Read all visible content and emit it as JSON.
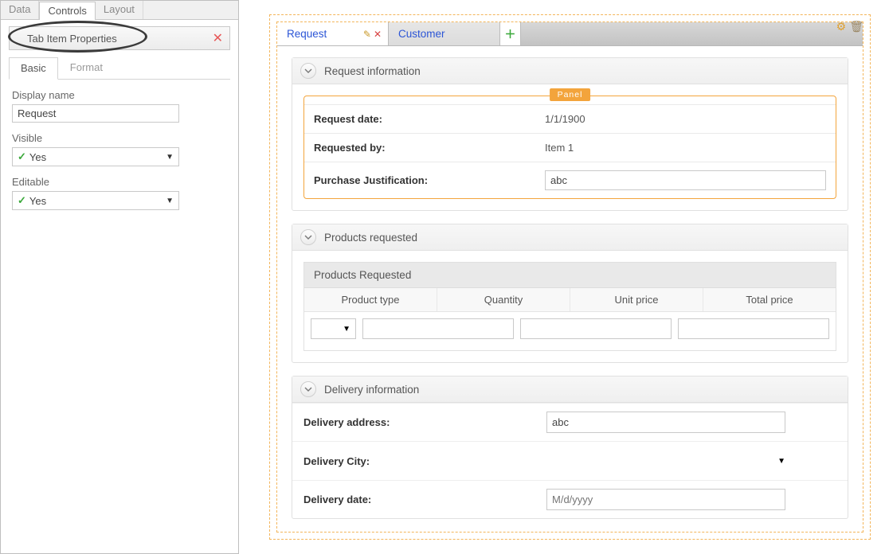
{
  "sidebar": {
    "tabs": [
      "Data",
      "Controls",
      "Layout"
    ],
    "panel_title": "Tab Item Properties",
    "subtabs": [
      "Basic",
      "Format"
    ],
    "display_name_label": "Display name",
    "display_name_value": "Request",
    "visible_label": "Visible",
    "visible_value": "Yes",
    "editable_label": "Editable",
    "editable_value": "Yes"
  },
  "canvas": {
    "tabs": [
      {
        "label": "Request",
        "active": true
      },
      {
        "label": "Customer",
        "active": false
      }
    ],
    "panel_badge": "Panel",
    "sec_request_title": "Request information",
    "request_date_label": "Request date:",
    "request_date_value": "1/1/1900",
    "requested_by_label": "Requested by:",
    "requested_by_value": "Item 1",
    "purchase_just_label": "Purchase Justification:",
    "purchase_just_value": "abc",
    "sec_products_title": "Products requested",
    "table_title": "Products Requested",
    "table_cols": [
      "Product type",
      "Quantity",
      "Unit price",
      "Total price"
    ],
    "sec_delivery_title": "Delivery information",
    "delivery_address_label": "Delivery address:",
    "delivery_address_value": "abc",
    "delivery_city_label": "Delivery City:",
    "delivery_city_value": "",
    "delivery_date_label": "Delivery date:",
    "delivery_date_placeholder": "M/d/yyyy"
  }
}
